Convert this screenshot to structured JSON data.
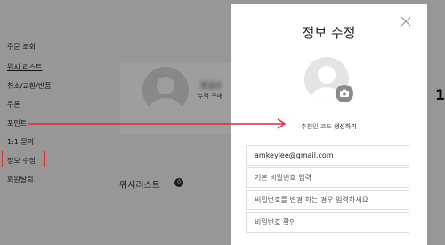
{
  "sidebar": {
    "items": [
      {
        "label": "주문 조회"
      },
      {
        "label": "위시 리스트"
      },
      {
        "label": "취소/교환/반품"
      },
      {
        "label": "쿠폰"
      },
      {
        "label": "포인트"
      },
      {
        "label": "1:1 문의"
      },
      {
        "label": "정보 수정"
      },
      {
        "label": "회원탈퇴"
      }
    ]
  },
  "background": {
    "profile_name": "홍길순",
    "profile_sub": "누적 구매",
    "wishlist_label": "위시리스트",
    "wishlist_count": "0",
    "edge_number": "1"
  },
  "modal": {
    "title": "정보 수정",
    "referral_prefix": "추천인 코드",
    "referral_action": "생성하기",
    "email_value": "amkeylee@gmail.com",
    "current_password_placeholder": "기본 비밀번호 입력",
    "new_password_placeholder": "비밀번호를 변경 하는 경우 입력하세요",
    "confirm_password_placeholder": "비밀번호 확인"
  },
  "colors": {
    "annotation_red": "#e0283c",
    "overlay": "rgba(0,0,0,0.38)"
  }
}
